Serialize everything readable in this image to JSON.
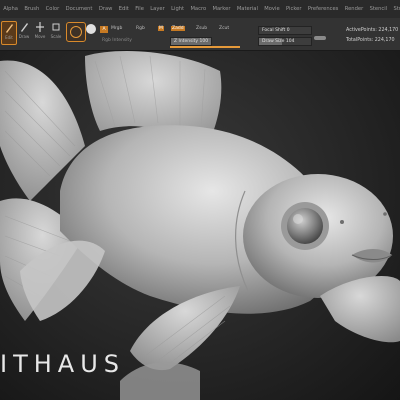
{
  "menu": {
    "items": [
      "Alpha",
      "Brush",
      "Color",
      "Document",
      "Draw",
      "Edit",
      "File",
      "Layer",
      "Light",
      "Macro",
      "Marker",
      "Material",
      "Movie",
      "Picker",
      "Preferences",
      "Render",
      "Stencil",
      "Stroke",
      "Texture",
      "Tool",
      "Transform",
      "Zplugin",
      "Zscript",
      "Help"
    ],
    "right": "AC  QuickSave"
  },
  "toolbar": {
    "tools": [
      {
        "label": "Edit",
        "icon": "edit-icon"
      },
      {
        "label": "Draw",
        "icon": "draw-icon"
      },
      {
        "label": "Move",
        "icon": "move-icon"
      },
      {
        "label": "Scale",
        "icon": "scale-icon"
      },
      {
        "label": "Rotate",
        "icon": "rotate-icon"
      }
    ],
    "a_label": "A",
    "mrgb": "Mrgb",
    "rgb": "Rgb",
    "m": "M",
    "zadd": "Zadd",
    "zsub": "Zsub",
    "zcut": "Zcut",
    "rgb_intensity": "Rgb Intensity",
    "z_intensity": "Z Intensity 100",
    "focal_shift": "Focal Shift 0",
    "draw_size": "Draw Size 104",
    "active_points": "ActivePoints: 224,170",
    "total_points": "TotalPoints: 224,170",
    "accent_color": "#e69a3a"
  },
  "viewport": {
    "watermark": "ITHAUS",
    "background": "#262626",
    "model_color": "#bdbdbd"
  }
}
